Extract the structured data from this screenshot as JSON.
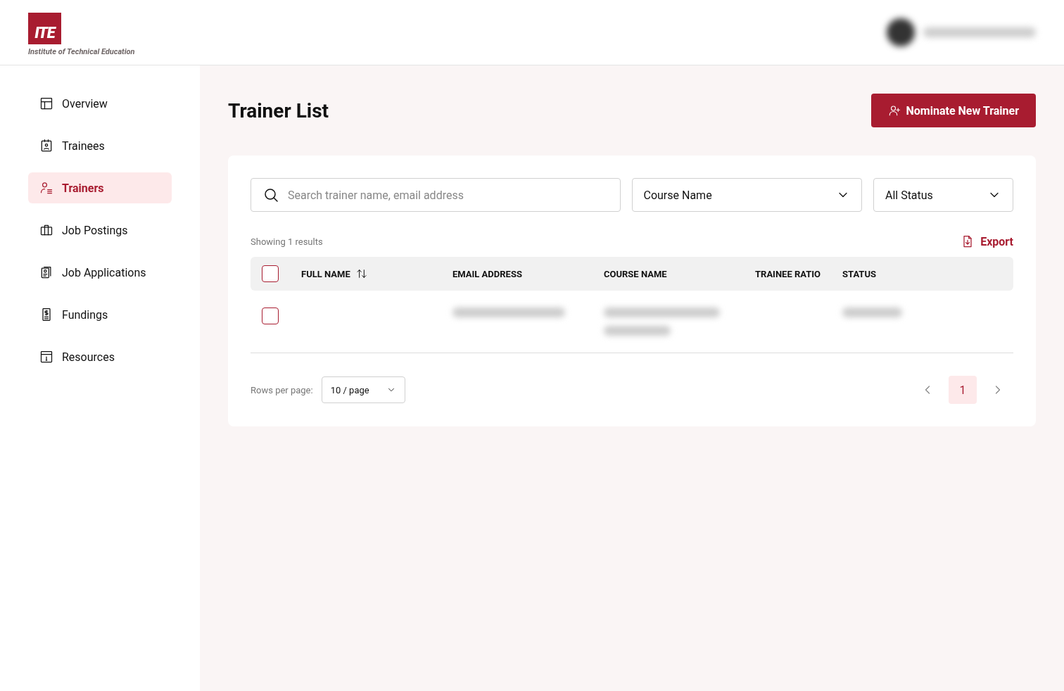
{
  "header": {
    "logo_mark": "ITE",
    "logo_caption": "Institute of Technical Education"
  },
  "sidebar": {
    "items": [
      {
        "label": "Overview",
        "selected": false
      },
      {
        "label": "Trainees",
        "selected": false
      },
      {
        "label": "Trainers",
        "selected": true
      },
      {
        "label": "Job Postings",
        "selected": false
      },
      {
        "label": "Job Applications",
        "selected": false
      },
      {
        "label": "Fundings",
        "selected": false
      },
      {
        "label": "Resources",
        "selected": false
      }
    ]
  },
  "page": {
    "title": "Trainer List",
    "primary_button": "Nominate New Trainer"
  },
  "filters": {
    "search": {
      "placeholder": "Search trainer name, email address"
    },
    "course": {
      "value": "Course Name"
    },
    "status": {
      "value": "All Status"
    }
  },
  "results": {
    "summary": "Showing 1 results",
    "export": "Export"
  },
  "table": {
    "select_all": {
      "checked": false
    },
    "columns": [
      {
        "label": "FULL NAME",
        "sortable": true
      },
      {
        "label": "EMAIL ADDRESS",
        "sortable": false
      },
      {
        "label": "COURSE NAME",
        "sortable": false
      },
      {
        "label": "TRAINEE RATIO",
        "sortable": false
      },
      {
        "label": "STATUS",
        "sortable": false
      }
    ],
    "rows": [
      {
        "checked": false
      }
    ]
  },
  "pagination": {
    "rows_label": "Rows per page:",
    "page_size": "10 / page",
    "pages": [
      {
        "label": "1",
        "selected": true
      }
    ]
  }
}
